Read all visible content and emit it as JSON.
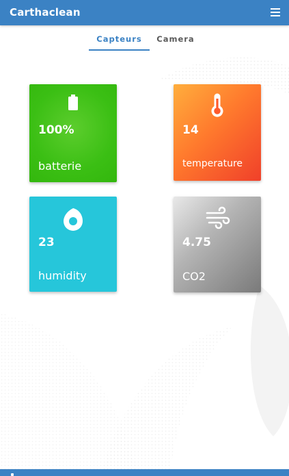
{
  "app": {
    "title": "Carthaclean"
  },
  "tabs": [
    {
      "label": "Capteurs",
      "active": true
    },
    {
      "label": "Camera",
      "active": false
    }
  ],
  "cards": [
    {
      "value": "100%",
      "label": "batterie",
      "icon": "battery-icon"
    },
    {
      "value": "14",
      "label": "temperature",
      "icon": "thermometer-icon"
    },
    {
      "value": "23",
      "label": "humidity",
      "icon": "humidity-drop-icon"
    },
    {
      "value": "4.75",
      "label": "CO2",
      "icon": "wind-icon"
    }
  ],
  "colors": {
    "app_bar": "#3b82c4",
    "active_tab": "#3b82c4",
    "battery_card": "#3bbf14",
    "temperature_card": "#ff7a2d",
    "humidity_card": "#26c6da",
    "co2_card": "#9e9e9e"
  }
}
